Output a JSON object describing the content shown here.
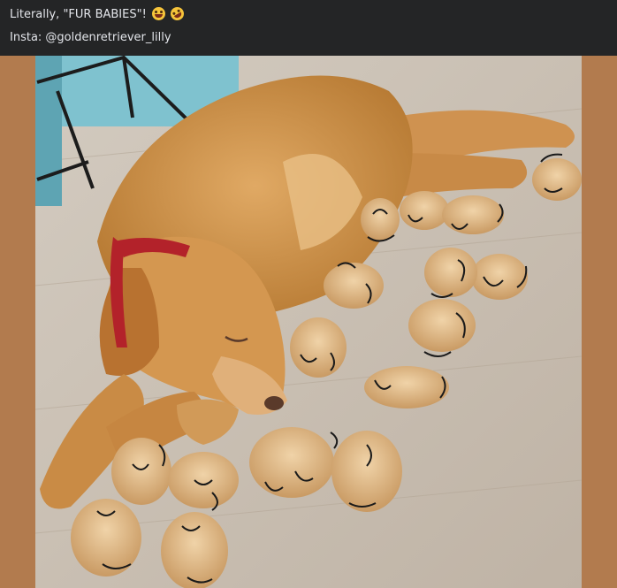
{
  "post": {
    "caption_line1": "Literally, \"FUR BABIES\"!",
    "caption_line1_emojis": [
      "grinning-sweat-emoji",
      "rofl-emoji"
    ],
    "caption_line2": "Insta: @goldenretriever_lilly"
  },
  "photo": {
    "subject": "sleeping golden retriever surrounded by fur clumps drawn as puppies",
    "colors": {
      "frame": "#b27b4e",
      "header": "#242526",
      "caption_text": "#e4e6eb",
      "floor": "#c9bfb3",
      "dog_fur": "#c98d45",
      "bandana": "#b3222a"
    }
  }
}
